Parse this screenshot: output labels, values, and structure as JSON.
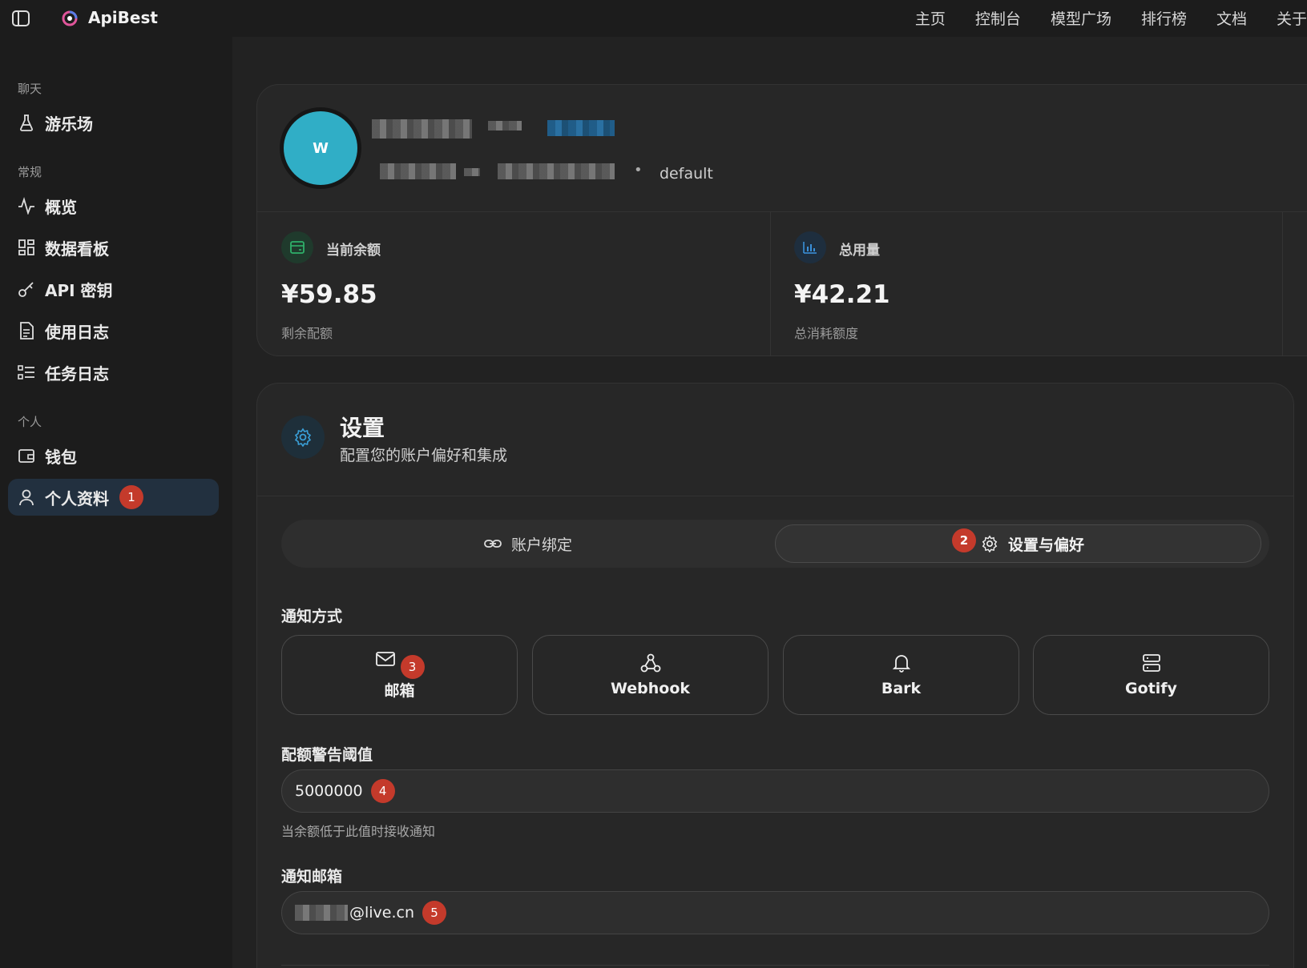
{
  "topbar": {
    "brand": "ApiBest",
    "nav": [
      "主页",
      "控制台",
      "模型广场",
      "排行榜",
      "文档",
      "关于"
    ]
  },
  "sidebar": {
    "groups": {
      "chat": "聊天",
      "general": "常规",
      "personal": "个人"
    },
    "items": [
      {
        "label": "游乐场",
        "icon": "flask-icon"
      },
      {
        "label": "概览",
        "icon": "activity-icon"
      },
      {
        "label": "数据看板",
        "icon": "dashboard-icon"
      },
      {
        "label": "API 密钥",
        "icon": "key-icon"
      },
      {
        "label": "使用日志",
        "icon": "document-icon"
      },
      {
        "label": "任务日志",
        "icon": "checklist-icon"
      },
      {
        "label": "钱包",
        "icon": "wallet-icon"
      },
      {
        "label": "个人资料",
        "icon": "user-icon",
        "active": true,
        "badge": "1"
      }
    ]
  },
  "profile": {
    "avatar_letter": "W",
    "group": "default",
    "stats": [
      {
        "title": "当前余额",
        "value": "¥59.85",
        "sub": "剩余配额",
        "icon": "wallet-icon",
        "accent": "#2fb06a"
      },
      {
        "title": "总用量",
        "value": "¥42.21",
        "sub": "总消耗额度",
        "icon": "bar-chart-icon",
        "accent": "#3a8fd8"
      }
    ]
  },
  "settings": {
    "title": "设置",
    "subtitle": "配置您的账户偏好和集成",
    "tabs": [
      {
        "label": "账户绑定",
        "icon": "link-icon"
      },
      {
        "label": "设置与偏好",
        "icon": "gear-icon",
        "active": true,
        "badge": "2"
      }
    ],
    "notify_label": "通知方式",
    "notify_options": [
      {
        "label": "邮箱",
        "icon": "mail-icon",
        "badge": "3"
      },
      {
        "label": "Webhook",
        "icon": "webhook-icon"
      },
      {
        "label": "Bark",
        "icon": "bell-icon"
      },
      {
        "label": "Gotify",
        "icon": "server-icon"
      }
    ],
    "threshold_label": "配额警告阈值",
    "threshold_value": "5000000",
    "threshold_badge": "4",
    "threshold_hint": "当余额低于此值时接收通知",
    "email_label": "通知邮箱",
    "email_value": "@live.cn",
    "email_badge": "5"
  },
  "colors": {
    "accent": "#30aec6",
    "badge": "#c43a2b",
    "active_bg": "#22303f"
  }
}
